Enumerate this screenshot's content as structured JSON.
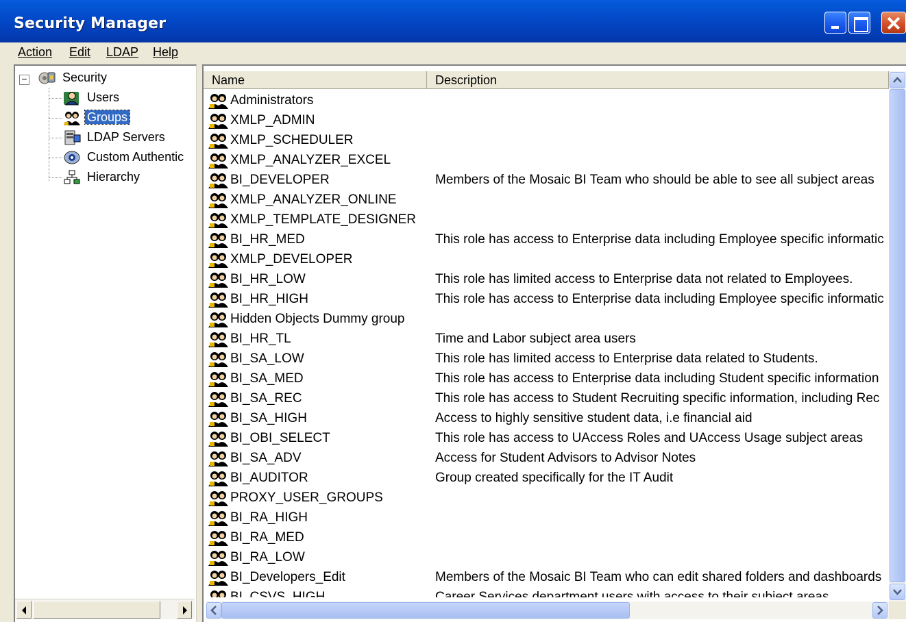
{
  "window": {
    "title": "Security Manager"
  },
  "menu": [
    {
      "label": "Action"
    },
    {
      "label": "Edit"
    },
    {
      "label": "LDAP"
    },
    {
      "label": "Help"
    }
  ],
  "tree": {
    "root": {
      "label": "Security",
      "icon": "security-icon",
      "expanded": true
    },
    "children": [
      {
        "label": "Users",
        "icon": "users-icon"
      },
      {
        "label": "Groups",
        "icon": "groups-icon",
        "selected": true
      },
      {
        "label": "LDAP Servers",
        "icon": "ldap-servers-icon"
      },
      {
        "label": "Custom Authentic",
        "icon": "custom-authenticator-icon"
      },
      {
        "label": "Hierarchy",
        "icon": "hierarchy-icon"
      }
    ]
  },
  "list": {
    "columns": [
      "Name",
      "Description"
    ],
    "rows": [
      {
        "name": "Administrators",
        "description": ""
      },
      {
        "name": "XMLP_ADMIN",
        "description": ""
      },
      {
        "name": "XMLP_SCHEDULER",
        "description": ""
      },
      {
        "name": "XMLP_ANALYZER_EXCEL",
        "description": ""
      },
      {
        "name": "BI_DEVELOPER",
        "description": "Members of the Mosaic BI Team who should be able to see all subject areas"
      },
      {
        "name": "XMLP_ANALYZER_ONLINE",
        "description": ""
      },
      {
        "name": "XMLP_TEMPLATE_DESIGNER",
        "description": ""
      },
      {
        "name": "BI_HR_MED",
        "description": "This role has access to Enterprise data including Employee specific informatic"
      },
      {
        "name": "XMLP_DEVELOPER",
        "description": ""
      },
      {
        "name": "BI_HR_LOW",
        "description": "This role has limited access to Enterprise data not related to Employees."
      },
      {
        "name": "BI_HR_HIGH",
        "description": "This role has access to Enterprise data including Employee specific informatic"
      },
      {
        "name": "Hidden Objects Dummy group",
        "description": ""
      },
      {
        "name": "BI_HR_TL",
        "description": "Time and Labor subject area users"
      },
      {
        "name": "BI_SA_LOW",
        "description": "This role has limited access to Enterprise data related to Students."
      },
      {
        "name": "BI_SA_MED",
        "description": "This role has access to Enterprise data including Student specific information"
      },
      {
        "name": "BI_SA_REC",
        "description": "This role has access to Student Recruiting specific information, including Rec"
      },
      {
        "name": "BI_SA_HIGH",
        "description": "Access to highly sensitive student data, i.e financial aid"
      },
      {
        "name": "BI_OBI_SELECT",
        "description": "This role has access to UAccess Roles and UAccess Usage subject areas"
      },
      {
        "name": "BI_SA_ADV",
        "description": "Access for Student Advisors to Advisor Notes"
      },
      {
        "name": "BI_AUDITOR",
        "description": "Group created specifically for the IT Audit"
      },
      {
        "name": "PROXY_USER_GROUPS",
        "description": ""
      },
      {
        "name": "BI_RA_HIGH",
        "description": ""
      },
      {
        "name": "BI_RA_MED",
        "description": ""
      },
      {
        "name": "BI_RA_LOW",
        "description": ""
      },
      {
        "name": "BI_Developers_Edit",
        "description": "Members of the Mosaic BI Team who can edit shared folders and dashboards"
      },
      {
        "name": "BI_CSVS_HIGH",
        "description": "Career Services department users with access to their subject areas"
      }
    ]
  }
}
